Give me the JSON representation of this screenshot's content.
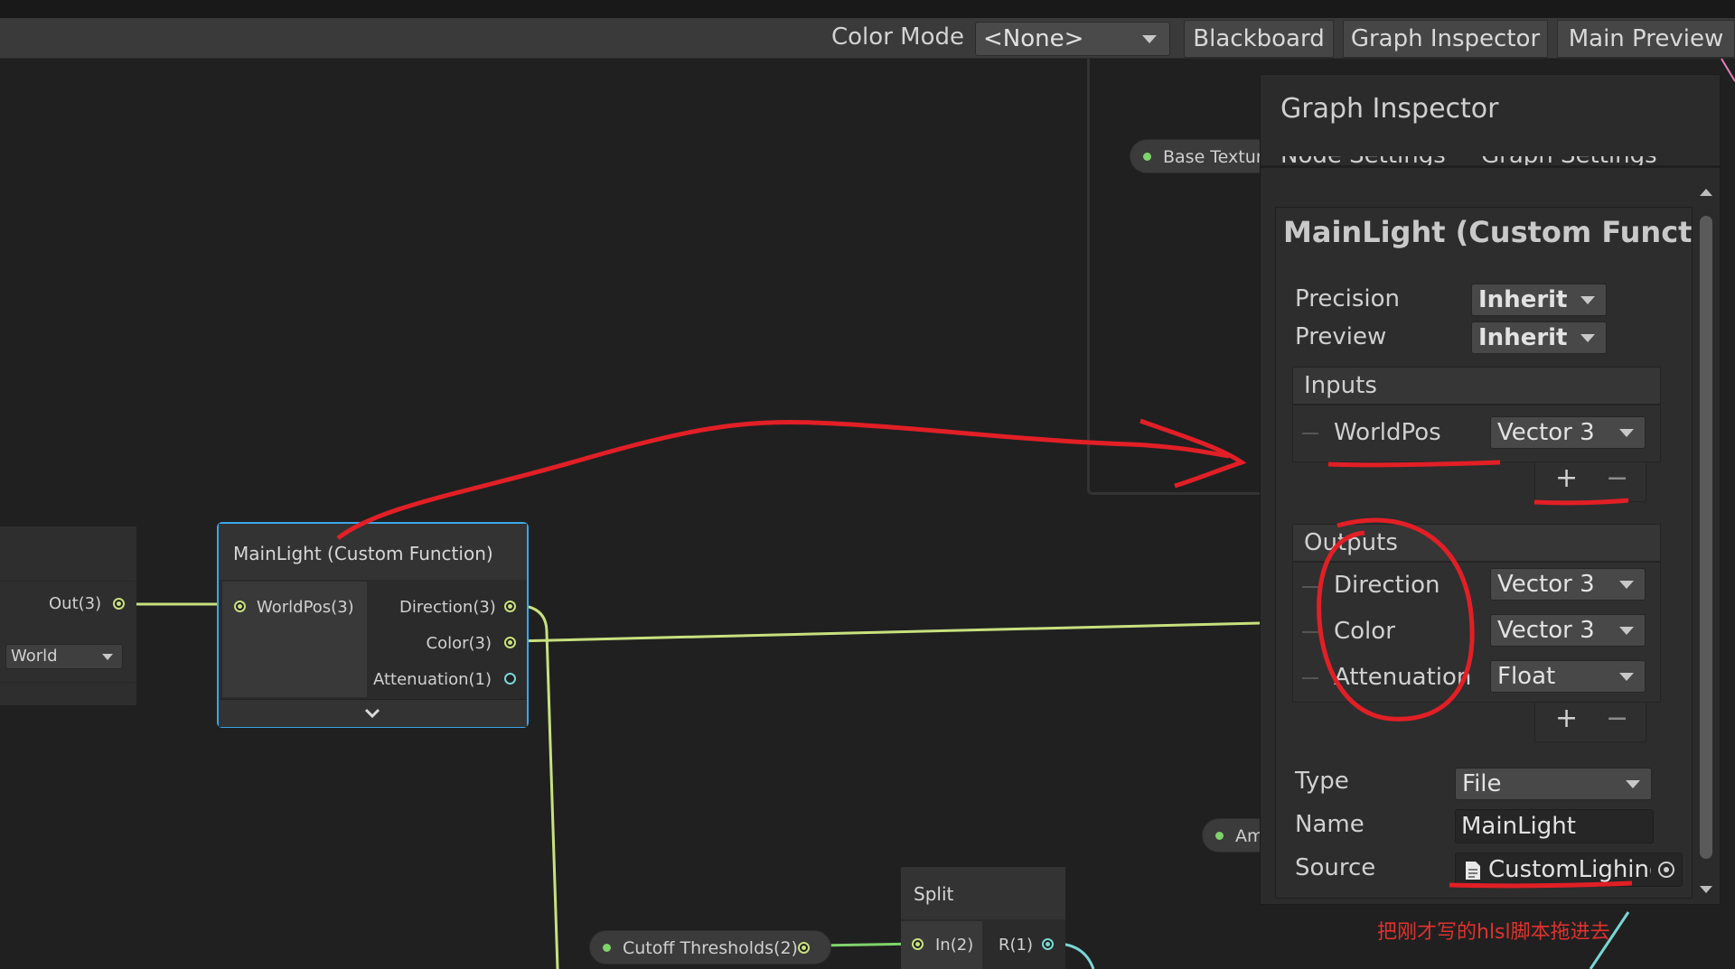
{
  "toolbar": {
    "color_mode_label": "Color Mode",
    "color_mode_value": "<None>",
    "blackboard_label": "Blackboard",
    "graph_inspector_label": "Graph Inspector",
    "main_preview_label": "Main Preview"
  },
  "graph": {
    "base_texture_label": "Base Textur",
    "am_label": "Am",
    "left_node": {
      "out_label": "Out(3)",
      "space_value": "World"
    },
    "node": {
      "title": "MainLight (Custom Function)",
      "inputs": [
        "WorldPos(3)"
      ],
      "outputs": [
        "Direction(3)",
        "Color(3)",
        "Attenuation(1)"
      ]
    },
    "cutoff_label": "Cutoff Thresholds(2)",
    "split": {
      "title": "Split",
      "input": "In(2)",
      "output": "R(1)"
    }
  },
  "inspector": {
    "title": "Graph Inspector",
    "tab_node_settings": "Node Settings",
    "tab_graph_settings": "Graph Settings",
    "node_title": "MainLight (Custom Function)",
    "precision_label": "Precision",
    "precision_value": "Inherit",
    "preview_label": "Preview",
    "preview_value": "Inherit",
    "inputs_header": "Inputs",
    "inputs": [
      {
        "name": "WorldPos",
        "type": "Vector 3"
      }
    ],
    "outputs_header": "Outputs",
    "outputs": [
      {
        "name": "Direction",
        "type": "Vector 3"
      },
      {
        "name": "Color",
        "type": "Vector 3"
      },
      {
        "name": "Attenuation",
        "type": "Float"
      }
    ],
    "plus": "+",
    "minus": "−",
    "type_label": "Type",
    "type_value": "File",
    "name_label": "Name",
    "name_value": "MainLight",
    "source_label": "Source",
    "source_value": "CustomLighing"
  },
  "annotation": {
    "text": "把刚才写的hlsl脚本拖进去"
  },
  "colors": {
    "accent": "#3aa6e6",
    "wire": "#c9e07e",
    "annotation": "#e0322e"
  }
}
